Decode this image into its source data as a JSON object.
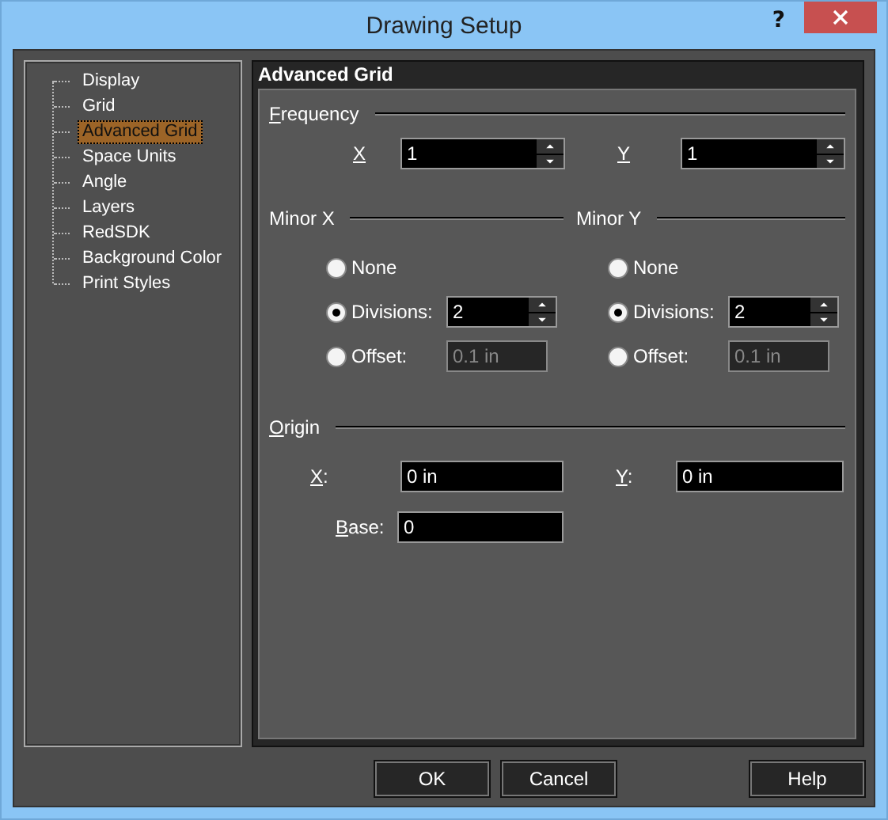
{
  "window": {
    "title": "Drawing Setup",
    "help": "?"
  },
  "tree": [
    {
      "label": "Display",
      "selected": false
    },
    {
      "label": "Grid",
      "selected": false
    },
    {
      "label": "Advanced Grid",
      "selected": true
    },
    {
      "label": "Space Units",
      "selected": false
    },
    {
      "label": "Angle",
      "selected": false
    },
    {
      "label": "Layers",
      "selected": false
    },
    {
      "label": "RedSDK",
      "selected": false
    },
    {
      "label": "Background Color",
      "selected": false
    },
    {
      "label": "Print Styles",
      "selected": false
    }
  ],
  "panel": {
    "title": "Advanced Grid",
    "frequency": {
      "heading": {
        "text": "Frequency",
        "mnemonic": true
      },
      "x": {
        "label": {
          "text": "X",
          "mnemonic": true
        },
        "value": "1"
      },
      "y": {
        "label": {
          "text": "Y",
          "mnemonic": true
        },
        "value": "1"
      }
    },
    "minor": [
      {
        "heading": {
          "text": "Minor X",
          "mnemonic": false
        },
        "options": [
          {
            "label": "None",
            "selected": false,
            "kind": "plain"
          },
          {
            "label": "Divisions:",
            "selected": true,
            "kind": "spin",
            "value": "2",
            "disabled": false
          },
          {
            "label": "Offset:",
            "selected": false,
            "kind": "field",
            "value": "0.1 in",
            "disabled": true
          }
        ]
      },
      {
        "heading": {
          "text": "Minor Y",
          "mnemonic": false
        },
        "options": [
          {
            "label": "None",
            "selected": false,
            "kind": "plain"
          },
          {
            "label": "Divisions:",
            "selected": true,
            "kind": "spin",
            "value": "2",
            "disabled": false
          },
          {
            "label": "Offset:",
            "selected": false,
            "kind": "field",
            "value": "0.1 in",
            "disabled": true
          }
        ]
      }
    ],
    "origin": {
      "heading": {
        "text": "Origin",
        "mnemonic": true
      },
      "x": {
        "label": {
          "text": "X:",
          "mnemonic": true
        },
        "value": "0 in"
      },
      "y": {
        "label": {
          "text": "Y:",
          "mnemonic": true
        },
        "value": "0 in"
      },
      "base": {
        "label": {
          "text": "Base:",
          "mnemonic": true
        },
        "value": "0"
      }
    }
  },
  "buttons": [
    "OK",
    "Cancel",
    "Help"
  ]
}
